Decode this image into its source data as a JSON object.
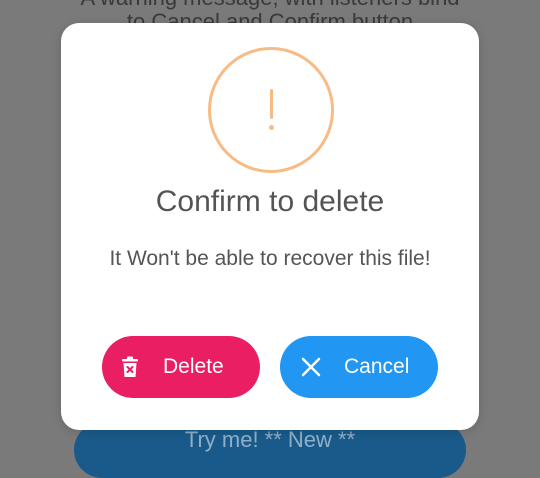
{
  "background": {
    "description_line1": "A warning message, with listeners bind",
    "description_line2": "to Cancel and Confirm button",
    "try_button_label": "Try me! ** New **"
  },
  "dialog": {
    "icon": "warning-exclamation-icon",
    "title": "Confirm to delete",
    "message": "It Won't be able to recover this file!",
    "buttons": {
      "confirm": {
        "label": "Delete",
        "icon": "trash-icon",
        "color": "#e91e63"
      },
      "cancel": {
        "label": "Cancel",
        "icon": "close-icon",
        "color": "#2196f3"
      }
    },
    "warning_color": "#f8bb86"
  }
}
